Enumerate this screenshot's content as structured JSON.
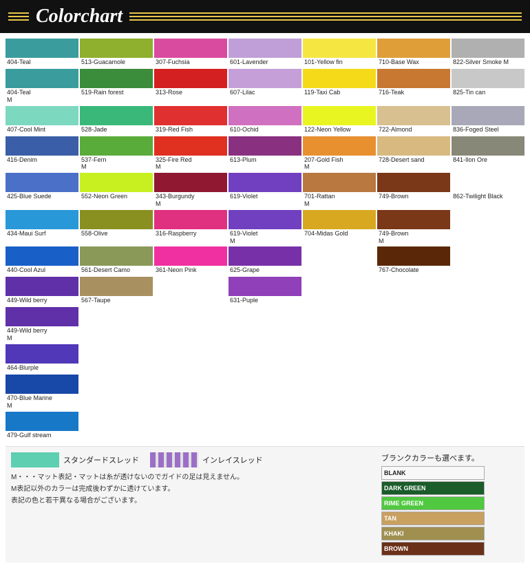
{
  "header": {
    "title": "Colorchart"
  },
  "colors": [
    {
      "id": "404-Teal",
      "swatch": "#3a9c9c",
      "label": "404-Teal",
      "m": false
    },
    {
      "id": "513-Guacamole",
      "swatch": "#8faf2e",
      "label": "513-Guacamole",
      "m": false
    },
    {
      "id": "307-Fuchsia",
      "swatch": "#d94b9e",
      "label": "307-Fuchsia",
      "m": false
    },
    {
      "id": "601-Lavender",
      "swatch": "#c09fd8",
      "label": "601-Lavender",
      "m": false
    },
    {
      "id": "101-Yellow fin",
      "swatch": "#f5e642",
      "label": "101-Yellow fin",
      "m": false
    },
    {
      "id": "710-Base Wax",
      "swatch": "#e09e38",
      "label": "710-Base Wax",
      "m": false
    },
    {
      "id": "822-Silver Smoke M",
      "swatch": "#b0b0b0",
      "label": "822-Silver Smoke M",
      "m": true
    },
    {
      "id": "404-Teal-2",
      "swatch": "#3a9c9c",
      "label": "404-Teal",
      "m": true
    },
    {
      "id": "519-Rain forest",
      "swatch": "#3b8c3b",
      "label": "519-Rain forest",
      "m": false
    },
    {
      "id": "313-Rose",
      "swatch": "#d42020",
      "label": "313-Rose",
      "m": false
    },
    {
      "id": "607-Lilac",
      "swatch": "#c49fd8",
      "label": "607-Lilac",
      "m": false
    },
    {
      "id": "119-Taxi Cab",
      "swatch": "#f5da1a",
      "label": "119-Taxi Cab",
      "m": false
    },
    {
      "id": "716-Teak",
      "swatch": "#c87830",
      "label": "716-Teak",
      "m": false
    },
    {
      "id": "825-Tin can",
      "swatch": "#c8c8c8",
      "label": "825-Tin can",
      "m": false
    },
    {
      "id": "407-Cool Mint",
      "swatch": "#7dd8c0",
      "label": "407-Cool Mint",
      "m": false
    },
    {
      "id": "528-Jade",
      "swatch": "#3ab87a",
      "label": "528-Jade",
      "m": false
    },
    {
      "id": "319-Red Fish",
      "swatch": "#e03030",
      "label": "319-Red Fish",
      "m": false
    },
    {
      "id": "610-Ochid",
      "swatch": "#d070c0",
      "label": "610-Ochid",
      "m": false
    },
    {
      "id": "122-Neon Yellow",
      "swatch": "#e8f520",
      "label": "122-Neon Yellow",
      "m": false
    },
    {
      "id": "722-Almond",
      "swatch": "#d8c090",
      "label": "722-Almond",
      "m": false
    },
    {
      "id": "836-Foged Steel",
      "swatch": "#a8a8b8",
      "label": "836-Foged Steel",
      "m": false
    },
    {
      "id": "416-Denim",
      "swatch": "#3a5fa8",
      "label": "416-Denim",
      "m": false
    },
    {
      "id": "537-Fern",
      "swatch": "#5aac3a",
      "label": "537-Fern",
      "m": true
    },
    {
      "id": "325-Fire Red",
      "swatch": "#e03020",
      "label": "325-Fire Red",
      "m": true
    },
    {
      "id": "613-Plum",
      "swatch": "#8a3080",
      "label": "613-Plum",
      "m": false
    },
    {
      "id": "207-Gold Fish",
      "swatch": "#e89030",
      "label": "207-Gold Fish",
      "m": true
    },
    {
      "id": "728-Desert sand",
      "swatch": "#d8ba80",
      "label": "728-Desert sand",
      "m": false
    },
    {
      "id": "841-Ilon Ore",
      "swatch": "#888878",
      "label": "841-Ilon Ore",
      "m": false
    },
    {
      "id": "425-Blue Suede",
      "swatch": "#4a70c8",
      "label": "425-Blue Suede",
      "m": false
    },
    {
      "id": "552-Neon Green",
      "swatch": "#c8f020",
      "label": "552-Neon Green",
      "m": false
    },
    {
      "id": "343-Burgundy",
      "swatch": "#901830",
      "label": "343-Burgundy",
      "m": true
    },
    {
      "id": "619-Violet",
      "swatch": "#7040c0",
      "label": "619-Violet",
      "m": false
    },
    {
      "id": "701-Rattan",
      "swatch": "#b87840",
      "label": "701-Rattan",
      "m": true
    },
    {
      "id": "749-Brown",
      "swatch": "#7a3818",
      "label": "749-Brown",
      "m": false
    },
    {
      "id": "862-Twilight Black",
      "swatch": null,
      "label": "862-Twilight Black",
      "m": false
    },
    {
      "id": "434-Maui Surf",
      "swatch": "#2898d8",
      "label": "434-Maui Surf",
      "m": false
    },
    {
      "id": "558-Olive",
      "swatch": "#8a9020",
      "label": "558-Olive",
      "m": false
    },
    {
      "id": "316-Raspberry",
      "swatch": "#e03080",
      "label": "316-Raspberry",
      "m": false
    },
    {
      "id": "619-Violet-2",
      "swatch": "#7040c0",
      "label": "619-Violet",
      "m": true
    },
    {
      "id": "704-Midas Gold",
      "swatch": "#d8a820",
      "label": "704-Midas Gold",
      "m": false
    },
    {
      "id": "749-Brown-2",
      "swatch": "#7a3818",
      "label": "749-Brown",
      "m": true
    },
    {
      "id": "empty1",
      "swatch": null,
      "label": "",
      "m": false
    },
    {
      "id": "440-Cool Azul",
      "swatch": "#1860c8",
      "label": "440-Cool Azul",
      "m": false
    },
    {
      "id": "561-Desert Camo",
      "swatch": "#8a9858",
      "label": "561-Desert Camo",
      "m": false
    },
    {
      "id": "361-Neon Pink",
      "swatch": "#f030a0",
      "label": "361-Neon Pink",
      "m": false
    },
    {
      "id": "625-Grape",
      "swatch": "#7830a8",
      "label": "625-Grape",
      "m": false
    },
    {
      "id": "empty2",
      "swatch": null,
      "label": "",
      "m": false
    },
    {
      "id": "767-Chocolate",
      "swatch": "#5a2808",
      "label": "767-Chocolate",
      "m": false
    },
    {
      "id": "empty3",
      "swatch": null,
      "label": "",
      "m": false
    },
    {
      "id": "449-Wild berry",
      "swatch": "#6030a8",
      "label": "449-Wild berry",
      "m": false
    },
    {
      "id": "567-Taupe",
      "swatch": "#a89060",
      "label": "567-Taupe",
      "m": false
    },
    {
      "id": "empty4",
      "swatch": null,
      "label": "",
      "m": false
    },
    {
      "id": "631-Puple",
      "swatch": "#9040b8",
      "label": "631-Puple",
      "m": false
    },
    {
      "id": "empty5",
      "swatch": null,
      "label": "",
      "m": false
    },
    {
      "id": "empty6",
      "swatch": null,
      "label": "",
      "m": false
    },
    {
      "id": "empty7",
      "swatch": null,
      "label": "",
      "m": false
    },
    {
      "id": "449-Wild berry-2",
      "swatch": "#6030a8",
      "label": "449-Wild berry",
      "m": true
    },
    {
      "id": "empty8",
      "swatch": null,
      "label": "",
      "m": false
    },
    {
      "id": "empty9",
      "swatch": null,
      "label": "",
      "m": false
    },
    {
      "id": "empty10",
      "swatch": null,
      "label": "",
      "m": false
    },
    {
      "id": "empty11",
      "swatch": null,
      "label": "",
      "m": false
    },
    {
      "id": "empty12",
      "swatch": null,
      "label": "",
      "m": false
    },
    {
      "id": "empty13",
      "swatch": null,
      "label": "",
      "m": false
    },
    {
      "id": "464-Blurple",
      "swatch": "#5038b8",
      "label": "464-Blurple",
      "m": false
    },
    {
      "id": "empty14",
      "swatch": null,
      "label": "",
      "m": false
    },
    {
      "id": "empty15",
      "swatch": null,
      "label": "",
      "m": false
    },
    {
      "id": "empty16",
      "swatch": null,
      "label": "",
      "m": false
    },
    {
      "id": "empty17",
      "swatch": null,
      "label": "",
      "m": false
    },
    {
      "id": "empty18",
      "swatch": null,
      "label": "",
      "m": false
    },
    {
      "id": "empty19",
      "swatch": null,
      "label": "",
      "m": false
    },
    {
      "id": "470-Blue Marine",
      "swatch": "#1848a8",
      "label": "470-Blue Marine",
      "m": true
    },
    {
      "id": "empty20",
      "swatch": null,
      "label": "",
      "m": false
    },
    {
      "id": "empty21",
      "swatch": null,
      "label": "",
      "m": false
    },
    {
      "id": "empty22",
      "swatch": null,
      "label": "",
      "m": false
    },
    {
      "id": "empty23",
      "swatch": null,
      "label": "",
      "m": false
    },
    {
      "id": "empty24",
      "swatch": null,
      "label": "",
      "m": false
    },
    {
      "id": "empty25",
      "swatch": null,
      "label": "",
      "m": false
    },
    {
      "id": "479-Gulf stream",
      "swatch": "#1878c8",
      "label": "479-Gulf stream",
      "m": false
    },
    {
      "id": "empty26",
      "swatch": null,
      "label": "",
      "m": false
    },
    {
      "id": "empty27",
      "swatch": null,
      "label": "",
      "m": false
    },
    {
      "id": "empty28",
      "swatch": null,
      "label": "",
      "m": false
    },
    {
      "id": "empty29",
      "swatch": null,
      "label": "",
      "m": false
    },
    {
      "id": "empty30",
      "swatch": null,
      "label": "",
      "m": false
    },
    {
      "id": "empty31",
      "swatch": null,
      "label": "",
      "m": false
    }
  ],
  "legend": {
    "standard_label": "スタンダードスレッド",
    "inlay_label": "インレイスレッド"
  },
  "notes": [
    "M・・・マット表記・マットは糸が透けないのでガイドの足は見えません。",
    "M表記以外のカラーは完成後わずかに透けています。",
    "表記の色と若干異なる場合がございます。"
  ],
  "blank_colors": {
    "title": "ブランクカラーも選べます。",
    "items": [
      {
        "label": "BLANK",
        "color": "#f8f8f8"
      },
      {
        "label": "DARK GREEN",
        "color": "#1a5c2a"
      },
      {
        "label": "RIME GREEN",
        "color": "#50c840"
      },
      {
        "label": "TAN",
        "color": "#c8a060"
      },
      {
        "label": "KHAKI",
        "color": "#a09050"
      },
      {
        "label": "BROWN",
        "color": "#6a3018"
      }
    ]
  }
}
